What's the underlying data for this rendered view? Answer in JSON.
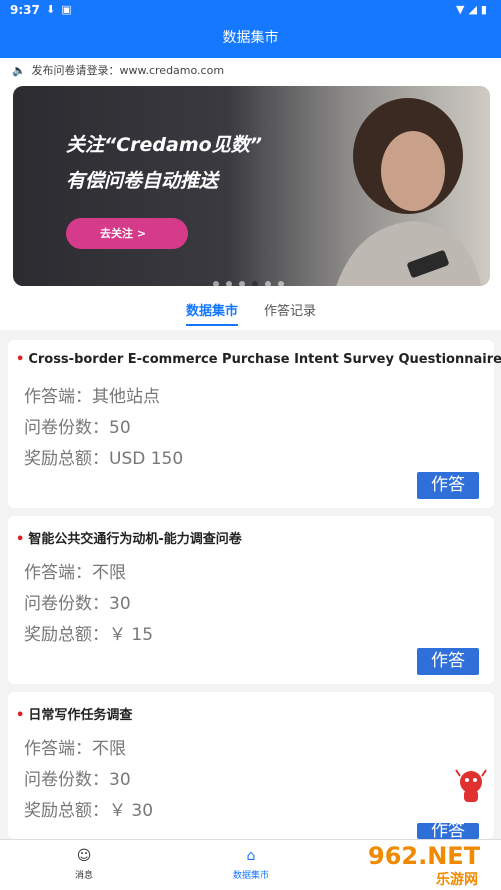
{
  "status": {
    "time": "9:37"
  },
  "header": {
    "title": "数据集市"
  },
  "notice": {
    "text": "发布问卷请登录：www.credamo.com"
  },
  "banner": {
    "line1": "关注“Credamo见数”",
    "line2": "有偿问卷自动推送",
    "button": "去关注 >",
    "slides": 6,
    "active_slide": 4
  },
  "tabs": [
    {
      "label": "数据集市",
      "active": true
    },
    {
      "label": "作答记录",
      "active": false
    }
  ],
  "cards": [
    {
      "title": "Cross-border E-commerce Purchase Intent Survey Questionnaire",
      "platform": "作答端：其他站点",
      "copies": "问卷份数：50",
      "reward": "奖励总额：USD 150",
      "action": "作答"
    },
    {
      "title": "智能公共交通行为动机-能力调查问卷",
      "platform": "作答端：不限",
      "copies": "问卷份数：30",
      "reward": "奖励总额：￥ 15",
      "action": "作答"
    },
    {
      "title": "日常写作任务调查",
      "platform": "作答端：不限",
      "copies": "问卷份数：30",
      "reward": "奖励总额：￥ 30",
      "action": "作答"
    }
  ],
  "bottom_nav": [
    {
      "label": "消息",
      "icon": "smile-icon"
    },
    {
      "label": "数据集市",
      "icon": "home-icon",
      "active": true
    }
  ],
  "watermark": {
    "text": "962.NET",
    "sub": "乐游网"
  },
  "colors": {
    "primary": "#1677ff",
    "button": "#2f6fd8",
    "banner_button": "#d63a8a",
    "bullet": "#e02020"
  }
}
